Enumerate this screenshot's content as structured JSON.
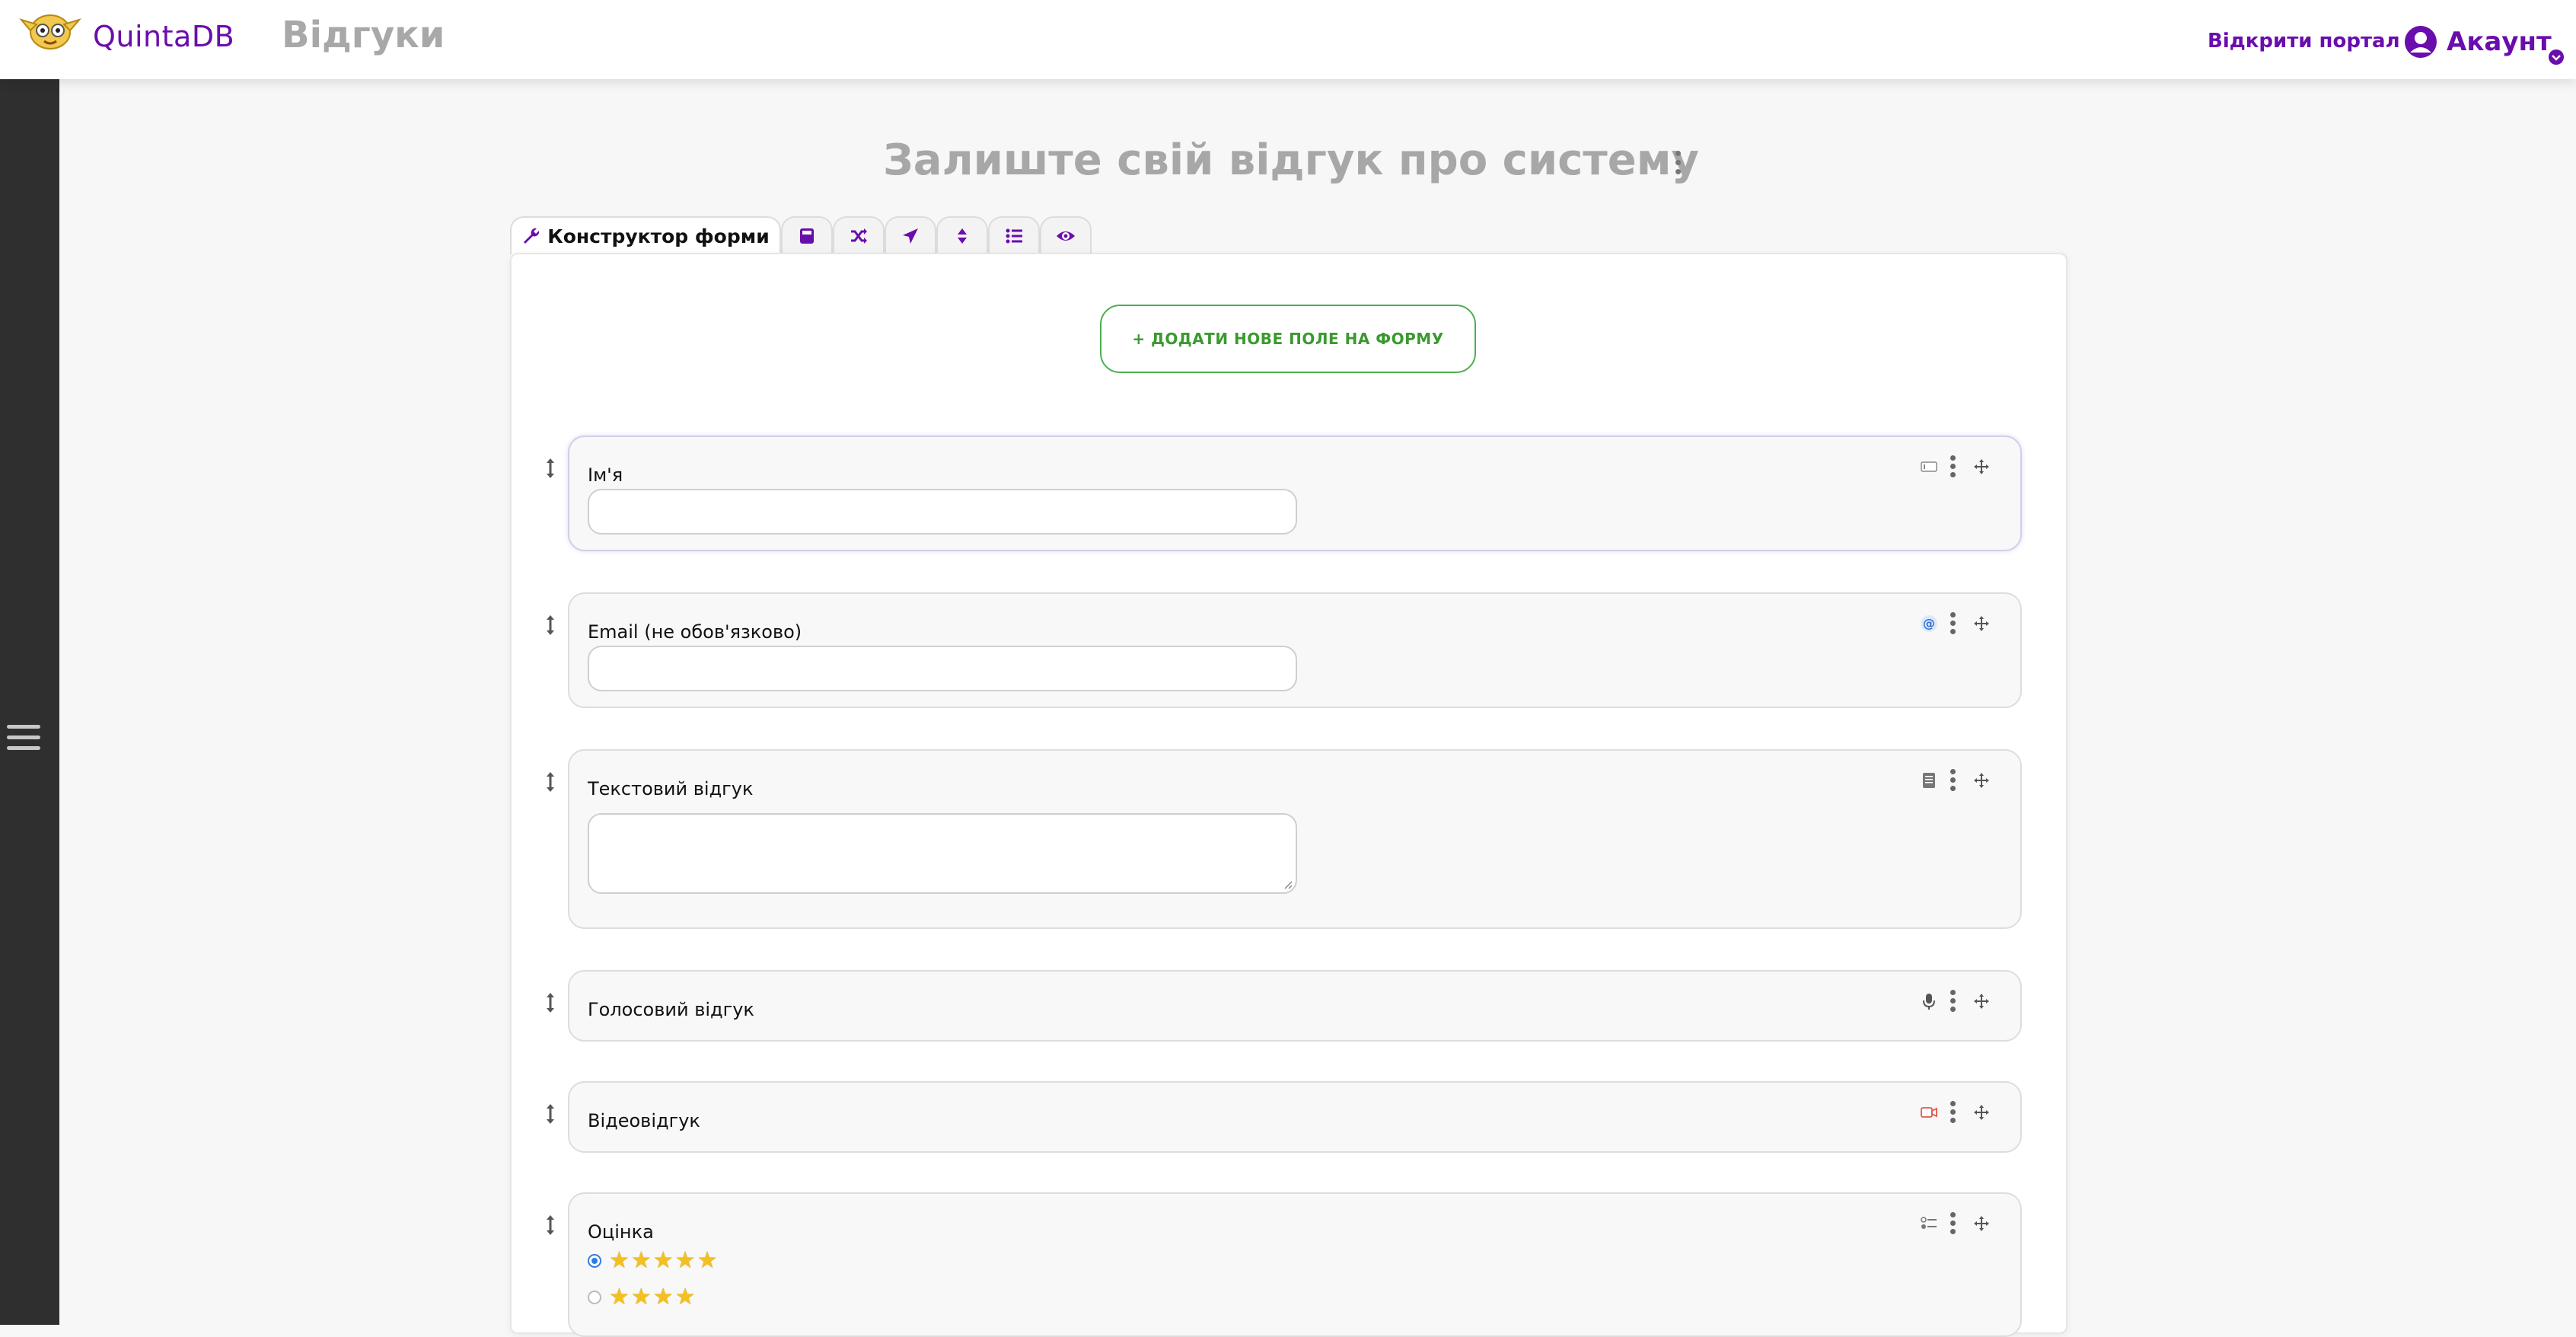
{
  "header": {
    "brand": "QuintaDB",
    "app_title": "Відгуки",
    "portal_link": "Відкрити портал",
    "account_label": "Акаунт"
  },
  "page": {
    "title": "Залиште свій відгук про систему"
  },
  "tabs": [
    {
      "label": "Конструктор форми",
      "icon": "wrench-icon",
      "active": true
    },
    {
      "label": "",
      "icon": "calculator-icon"
    },
    {
      "label": "",
      "icon": "shuffle-icon"
    },
    {
      "label": "",
      "icon": "paper-plane-icon"
    },
    {
      "label": "",
      "icon": "sort-icon"
    },
    {
      "label": "",
      "icon": "list-icon"
    },
    {
      "label": "",
      "icon": "eye-icon"
    }
  ],
  "form": {
    "add_field_label": "+ ДОДАТИ НОВЕ ПОЛЕ НА ФОРМУ",
    "fields": [
      {
        "label": "Ім'я",
        "type_icon": "text-field-icon",
        "control": "input"
      },
      {
        "label": "Email (не обов'язково)",
        "type_icon": "at-sign-icon",
        "control": "input"
      },
      {
        "label": "Текстовий відгук",
        "type_icon": "textarea-icon",
        "control": "textarea"
      },
      {
        "label": "Голосовий відгук",
        "type_icon": "microphone-icon",
        "control": "none"
      },
      {
        "label": "Відеовідгук",
        "type_icon": "video-icon",
        "control": "none"
      },
      {
        "label": "Оцінка",
        "type_icon": "radio-list-icon",
        "control": "radio",
        "options": [
          {
            "stars": "★★★★★",
            "checked": true
          },
          {
            "stars": "★★★★",
            "checked": false
          }
        ]
      }
    ]
  },
  "colors": {
    "brand": "#6a0dad",
    "add_button": "#3a9a2e",
    "sidebar": "#2f2f2f",
    "star": "#f3c022"
  }
}
